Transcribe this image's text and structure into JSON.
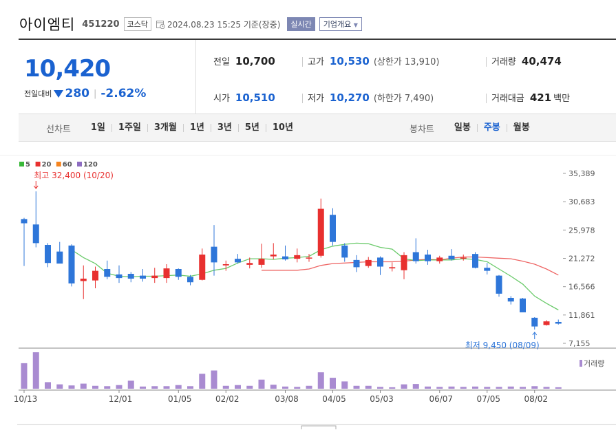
{
  "header": {
    "stock_name": "아이엠티",
    "stock_code": "451220",
    "market": "코스닥",
    "datetime": "2024.08.23 15:25 기준(장중)",
    "realtime_label": "실시간",
    "overview_label": "기업개요"
  },
  "quote": {
    "price": "10,420",
    "change_label": "전일대비",
    "change_value": "280",
    "change_rate": "-2.62%",
    "prev_close_label": "전일",
    "prev_close": "10,700",
    "open_label": "시가",
    "open": "10,510",
    "high_label": "고가",
    "high": "10,530",
    "upper_limit": "(상한가 13,910)",
    "low_label": "저가",
    "low": "10,270",
    "lower_limit": "(하한가 7,490)",
    "volume_label": "거래량",
    "volume": "40,474",
    "amount_label": "거래대금",
    "amount": "421",
    "amount_unit": "백만"
  },
  "tabs": {
    "line_label": "선차트",
    "line_periods": [
      "1일",
      "1주일",
      "3개월",
      "1년",
      "3년",
      "5년",
      "10년"
    ],
    "candle_label": "봉차트",
    "candle_periods": [
      "일봉",
      "주봉",
      "월봉"
    ],
    "candle_active": 1
  },
  "colors": {
    "up": "#e8302f",
    "down": "#2e76d9",
    "ma5": "#38b838",
    "ma20": "#e8302f",
    "ma60": "#f5841f",
    "ma120": "#8d6cc1",
    "volume": "#a98bd1",
    "price_blue": "#1a62d0"
  },
  "chart_data": {
    "type": "candlestick",
    "interval": "weekly",
    "legend": [
      {
        "name": "5",
        "color": "#38b838"
      },
      {
        "name": "20",
        "color": "#e8302f"
      },
      {
        "name": "60",
        "color": "#f5841f"
      },
      {
        "name": "120",
        "color": "#8d6cc1"
      }
    ],
    "ylim": [
      7155,
      35389
    ],
    "y_ticks": [
      "35,389",
      "30,683",
      "25,978",
      "21,272",
      "16,566",
      "11,861",
      "7,155"
    ],
    "x_tick_labels": [
      {
        "i": 0,
        "label": "10/13"
      },
      {
        "i": 8,
        "label": "12/01"
      },
      {
        "i": 13,
        "label": "01/05"
      },
      {
        "i": 17,
        "label": "02/02"
      },
      {
        "i": 22,
        "label": "03/08"
      },
      {
        "i": 26,
        "label": "04/05"
      },
      {
        "i": 30,
        "label": "05/03"
      },
      {
        "i": 35,
        "label": "06/07"
      },
      {
        "i": 39,
        "label": "07/05"
      },
      {
        "i": 43,
        "label": "08/02"
      }
    ],
    "max_annotation": {
      "i": 1,
      "label": "최고 32,400 (10/20)",
      "value": 32400
    },
    "min_annotation": {
      "i": 43,
      "label": "최저 9,450 (08/09)",
      "value": 9450
    },
    "volume_label": "거래량",
    "candles": [
      {
        "o": 27800,
        "h": 28000,
        "l": 20000,
        "c": 27100,
        "v": 0.7
      },
      {
        "o": 26900,
        "h": 32400,
        "l": 23100,
        "c": 23800,
        "v": 1.0
      },
      {
        "o": 23500,
        "h": 23800,
        "l": 19800,
        "c": 20500,
        "v": 0.18
      },
      {
        "o": 22400,
        "h": 24000,
        "l": 20500,
        "c": 20400,
        "v": 0.12
      },
      {
        "o": 23400,
        "h": 23600,
        "l": 16600,
        "c": 17100,
        "v": 0.09
      },
      {
        "o": 17500,
        "h": 20100,
        "l": 14500,
        "c": 17900,
        "v": 0.14
      },
      {
        "o": 17600,
        "h": 19900,
        "l": 16300,
        "c": 19200,
        "v": 0.08
      },
      {
        "o": 19500,
        "h": 20900,
        "l": 17800,
        "c": 18200,
        "v": 0.07
      },
      {
        "o": 18600,
        "h": 20100,
        "l": 17200,
        "c": 18000,
        "v": 0.1
      },
      {
        "o": 18700,
        "h": 19000,
        "l": 17300,
        "c": 17900,
        "v": 0.22
      },
      {
        "o": 18400,
        "h": 19500,
        "l": 17400,
        "c": 17900,
        "v": 0.06
      },
      {
        "o": 18000,
        "h": 19700,
        "l": 17200,
        "c": 18400,
        "v": 0.07
      },
      {
        "o": 18000,
        "h": 20300,
        "l": 17200,
        "c": 19600,
        "v": 0.07
      },
      {
        "o": 19500,
        "h": 19600,
        "l": 17700,
        "c": 18200,
        "v": 0.1
      },
      {
        "o": 18200,
        "h": 18500,
        "l": 16800,
        "c": 17300,
        "v": 0.07
      },
      {
        "o": 17700,
        "h": 22900,
        "l": 17600,
        "c": 21900,
        "v": 0.41
      },
      {
        "o": 23200,
        "h": 26800,
        "l": 18400,
        "c": 20600,
        "v": 0.5
      },
      {
        "o": 20100,
        "h": 20900,
        "l": 19200,
        "c": 20300,
        "v": 0.08
      },
      {
        "o": 21200,
        "h": 22000,
        "l": 20400,
        "c": 20600,
        "v": 0.1
      },
      {
        "o": 20200,
        "h": 21400,
        "l": 19600,
        "c": 20500,
        "v": 0.08
      },
      {
        "o": 20200,
        "h": 23700,
        "l": 19700,
        "c": 21200,
        "v": 0.25
      },
      {
        "o": 21600,
        "h": 23800,
        "l": 21100,
        "c": 21900,
        "v": 0.11
      },
      {
        "o": 21600,
        "h": 23400,
        "l": 20900,
        "c": 21100,
        "v": 0.06
      },
      {
        "o": 21200,
        "h": 22900,
        "l": 20600,
        "c": 21800,
        "v": 0.05
      },
      {
        "o": 21400,
        "h": 22000,
        "l": 20700,
        "c": 21400,
        "v": 0.08
      },
      {
        "o": 21700,
        "h": 31200,
        "l": 21400,
        "c": 29500,
        "v": 0.45
      },
      {
        "o": 28500,
        "h": 29600,
        "l": 23400,
        "c": 24000,
        "v": 0.3
      },
      {
        "o": 23400,
        "h": 23800,
        "l": 20700,
        "c": 21400,
        "v": 0.2
      },
      {
        "o": 21000,
        "h": 21800,
        "l": 19000,
        "c": 19800,
        "v": 0.08
      },
      {
        "o": 20000,
        "h": 21500,
        "l": 19700,
        "c": 21000,
        "v": 0.08
      },
      {
        "o": 21400,
        "h": 21600,
        "l": 18500,
        "c": 19900,
        "v": 0.05
      },
      {
        "o": 19600,
        "h": 20600,
        "l": 19100,
        "c": 19800,
        "v": 0.04
      },
      {
        "o": 19300,
        "h": 22300,
        "l": 17800,
        "c": 21800,
        "v": 0.12
      },
      {
        "o": 22300,
        "h": 24600,
        "l": 20400,
        "c": 20800,
        "v": 0.13
      },
      {
        "o": 21900,
        "h": 22700,
        "l": 20200,
        "c": 20800,
        "v": 0.06
      },
      {
        "o": 20800,
        "h": 21700,
        "l": 20400,
        "c": 21400,
        "v": 0.05
      },
      {
        "o": 21700,
        "h": 22800,
        "l": 20900,
        "c": 21100,
        "v": 0.06
      },
      {
        "o": 21400,
        "h": 21900,
        "l": 20900,
        "c": 21400,
        "v": 0.05
      },
      {
        "o": 22000,
        "h": 22300,
        "l": 19600,
        "c": 19700,
        "v": 0.06
      },
      {
        "o": 19700,
        "h": 20500,
        "l": 18600,
        "c": 19200,
        "v": 0.05
      },
      {
        "o": 18400,
        "h": 18500,
        "l": 14900,
        "c": 15400,
        "v": 0.05
      },
      {
        "o": 14700,
        "h": 15000,
        "l": 13600,
        "c": 14100,
        "v": 0.06
      },
      {
        "o": 14600,
        "h": 14700,
        "l": 12300,
        "c": 12300,
        "v": 0.05
      },
      {
        "o": 11400,
        "h": 11500,
        "l": 9450,
        "c": 9950,
        "v": 0.07
      },
      {
        "o": 10200,
        "h": 11000,
        "l": 10100,
        "c": 10800,
        "v": 0.05
      },
      {
        "o": 10700,
        "h": 11100,
        "l": 10270,
        "c": 10420,
        "v": 0.04
      }
    ],
    "ma5": [
      null,
      null,
      null,
      null,
      22700,
      21400,
      20400,
      18800,
      18300,
      18200,
      18300,
      18300,
      18400,
      18500,
      18300,
      18700,
      19300,
      19600,
      20500,
      21200,
      21200,
      21100,
      21300,
      21400,
      21600,
      22700,
      23300,
      23600,
      23800,
      23700,
      23100,
      22800,
      21200,
      20900,
      21000,
      21000,
      21000,
      21200,
      21100,
      20700,
      19500,
      18300,
      17000,
      15000,
      13800,
      12700
    ],
    "ma20": [
      null,
      null,
      null,
      null,
      null,
      null,
      null,
      null,
      null,
      null,
      null,
      null,
      null,
      null,
      null,
      null,
      null,
      null,
      null,
      null,
      19300,
      19300,
      19300,
      19300,
      19500,
      20100,
      20400,
      20500,
      20600,
      20700,
      20700,
      20700,
      20800,
      21000,
      21100,
      21000,
      21300,
      21500,
      21500,
      21400,
      21300,
      21200,
      20800,
      20300,
      19500,
      18500
    ]
  }
}
